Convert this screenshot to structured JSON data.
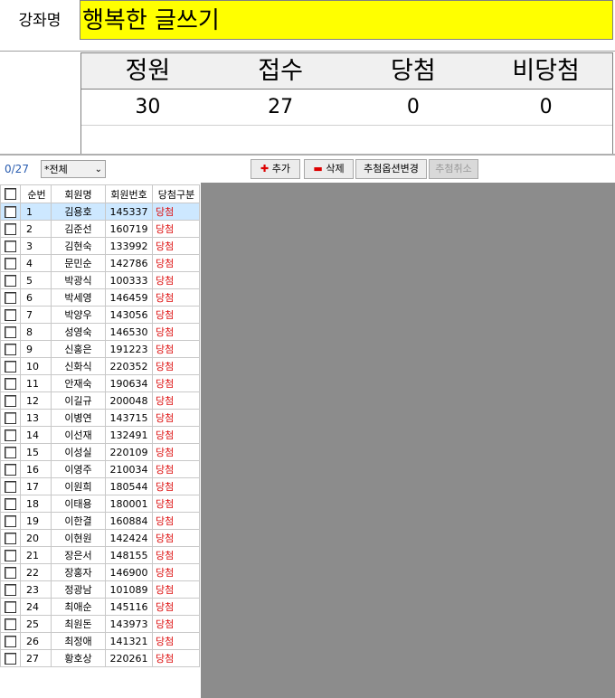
{
  "course": {
    "label": "강좌명",
    "name": "행복한 글쓰기"
  },
  "stats": {
    "headers": [
      "정원",
      "접수",
      "당첨",
      "비당첨"
    ],
    "values": [
      "30",
      "27",
      "0",
      "0"
    ]
  },
  "toolbar": {
    "count": "0/27",
    "filter": "*전체",
    "add": "추가",
    "delete": "삭제",
    "change_options": "추첨옵션변경",
    "cancel_draw": "추첨취소"
  },
  "grid": {
    "headers": {
      "num": "순번",
      "name": "회원명",
      "code": "회원번호",
      "status": "당첨구분"
    },
    "rows": [
      {
        "num": "1",
        "name": "김용호",
        "code": "145337",
        "status": "당첨"
      },
      {
        "num": "2",
        "name": "김준선",
        "code": "160719",
        "status": "당첨"
      },
      {
        "num": "3",
        "name": "김현숙",
        "code": "133992",
        "status": "당첨"
      },
      {
        "num": "4",
        "name": "문민순",
        "code": "142786",
        "status": "당첨"
      },
      {
        "num": "5",
        "name": "박광식",
        "code": "100333",
        "status": "당첨"
      },
      {
        "num": "6",
        "name": "박세영",
        "code": "146459",
        "status": "당첨"
      },
      {
        "num": "7",
        "name": "박양우",
        "code": "143056",
        "status": "당첨"
      },
      {
        "num": "8",
        "name": "성영숙",
        "code": "146530",
        "status": "당첨"
      },
      {
        "num": "9",
        "name": "신홍은",
        "code": "191223",
        "status": "당첨"
      },
      {
        "num": "10",
        "name": "신화식",
        "code": "220352",
        "status": "당첨"
      },
      {
        "num": "11",
        "name": "안재숙",
        "code": "190634",
        "status": "당첨"
      },
      {
        "num": "12",
        "name": "이길규",
        "code": "200048",
        "status": "당첨"
      },
      {
        "num": "13",
        "name": "이병연",
        "code": "143715",
        "status": "당첨"
      },
      {
        "num": "14",
        "name": "이선재",
        "code": "132491",
        "status": "당첨"
      },
      {
        "num": "15",
        "name": "이성실",
        "code": "220109",
        "status": "당첨"
      },
      {
        "num": "16",
        "name": "이영주",
        "code": "210034",
        "status": "당첨"
      },
      {
        "num": "17",
        "name": "이원희",
        "code": "180544",
        "status": "당첨"
      },
      {
        "num": "18",
        "name": "이태용",
        "code": "180001",
        "status": "당첨"
      },
      {
        "num": "19",
        "name": "이한결",
        "code": "160884",
        "status": "당첨"
      },
      {
        "num": "20",
        "name": "이현원",
        "code": "142424",
        "status": "당첨"
      },
      {
        "num": "21",
        "name": "장은서",
        "code": "148155",
        "status": "당첨"
      },
      {
        "num": "22",
        "name": "장홍자",
        "code": "146900",
        "status": "당첨"
      },
      {
        "num": "23",
        "name": "정광남",
        "code": "101089",
        "status": "당첨"
      },
      {
        "num": "24",
        "name": "최애순",
        "code": "145116",
        "status": "당첨"
      },
      {
        "num": "25",
        "name": "최원돈",
        "code": "143973",
        "status": "당첨"
      },
      {
        "num": "26",
        "name": "최정애",
        "code": "141321",
        "status": "당첨"
      },
      {
        "num": "27",
        "name": "황호상",
        "code": "220261",
        "status": "당첨"
      }
    ]
  }
}
